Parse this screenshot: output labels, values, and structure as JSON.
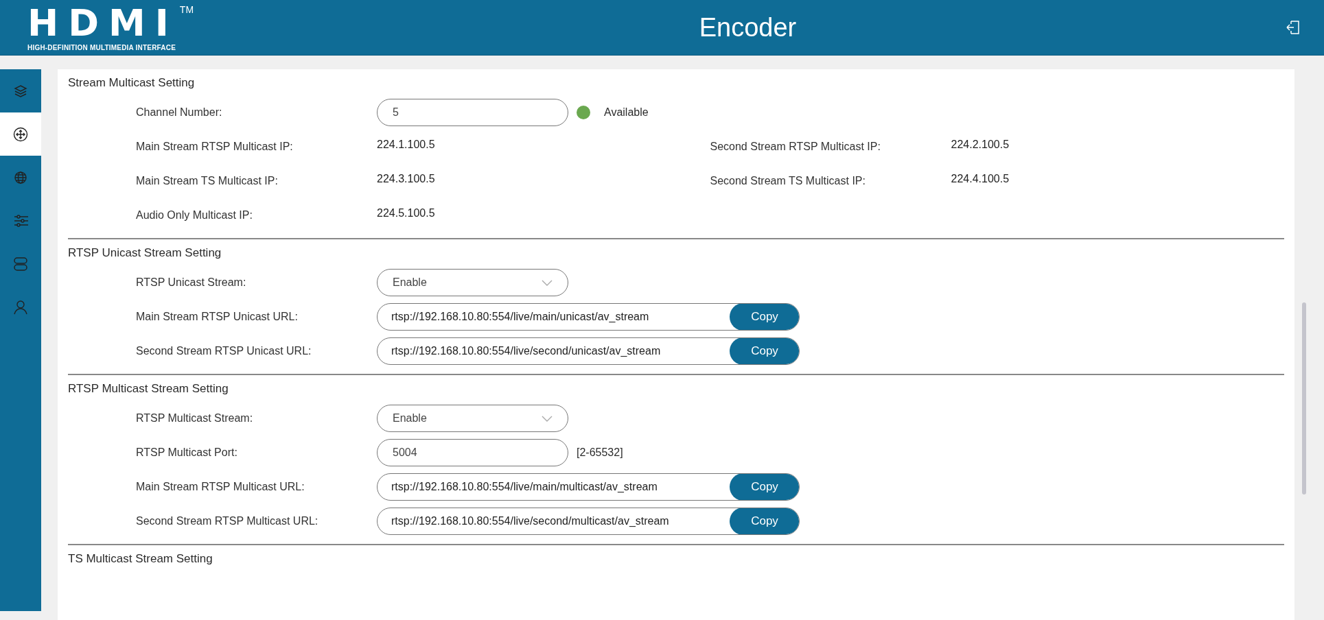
{
  "header": {
    "logo": {
      "mark": "HDMI",
      "tm": "TM",
      "tagline": "HIGH-DEFINITION MULTIMEDIA INTERFACE"
    },
    "title": "Encoder"
  },
  "sidebar": {
    "items": [
      {
        "selected": false
      },
      {
        "selected": true
      },
      {
        "selected": false
      },
      {
        "selected": false
      },
      {
        "selected": false
      },
      {
        "selected": false
      }
    ]
  },
  "sections": [
    {
      "title": "Stream Multicast Setting",
      "rows": [
        {
          "kind": "input",
          "label": "Channel Number:",
          "value": "5",
          "status": {
            "text": "Available",
            "color": "#6aa84f"
          }
        },
        {
          "kind": "info",
          "cells": [
            {
              "label": "Main Stream RTSP Multicast IP:",
              "value": "224.1.100.5"
            },
            {
              "label": "Second Stream RTSP Multicast IP:",
              "value": "224.2.100.5"
            }
          ]
        },
        {
          "kind": "info",
          "cells": [
            {
              "label": "Main Stream TS Multicast IP:",
              "value": "224.3.100.5"
            },
            {
              "label": "Second Stream TS Multicast IP:",
              "value": "224.4.100.5"
            }
          ]
        },
        {
          "kind": "info",
          "cells": [
            {
              "label": "Audio Only Multicast IP:",
              "value": "224.5.100.5"
            }
          ]
        }
      ]
    },
    {
      "title": "RTSP Unicast Stream Setting",
      "rows": [
        {
          "kind": "select",
          "label": "RTSP Unicast Stream:",
          "value": "Enable"
        },
        {
          "kind": "url",
          "label": "Main Stream RTSP Unicast URL:",
          "value": "rtsp://192.168.10.80:554/live/main/unicast/av_stream",
          "button": "Copy"
        },
        {
          "kind": "url",
          "label": "Second Stream RTSP Unicast URL:",
          "value": "rtsp://192.168.10.80:554/live/second/unicast/av_stream",
          "button": "Copy"
        }
      ]
    },
    {
      "title": "RTSP Multicast Stream Setting",
      "rows": [
        {
          "kind": "select",
          "label": "RTSP Multicast Stream:",
          "value": "Enable"
        },
        {
          "kind": "input",
          "label": "RTSP Multicast Port:",
          "value": "5004",
          "hint": "[2-65532]"
        },
        {
          "kind": "url",
          "label": "Main Stream RTSP Multicast URL:",
          "value": "rtsp://192.168.10.80:554/live/main/multicast/av_stream",
          "button": "Copy"
        },
        {
          "kind": "url",
          "label": "Second Stream RTSP Multicast URL:",
          "value": "rtsp://192.168.10.80:554/live/second/multicast/av_stream",
          "button": "Copy"
        }
      ]
    },
    {
      "title": "TS Multicast Stream Setting"
    }
  ]
}
